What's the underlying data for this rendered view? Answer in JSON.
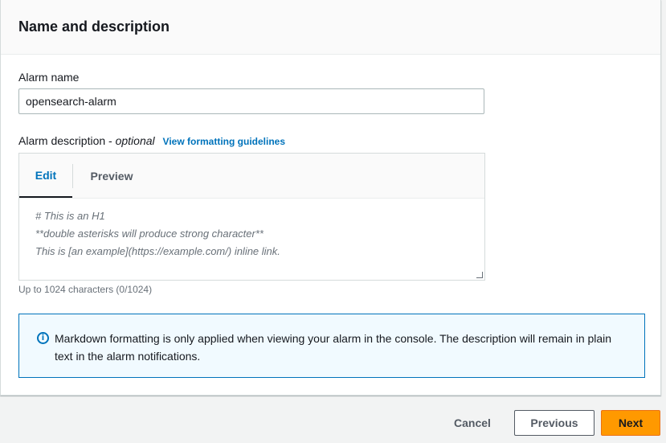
{
  "section": {
    "title": "Name and description"
  },
  "alarm_name": {
    "label": "Alarm name",
    "value": "opensearch-alarm"
  },
  "alarm_description": {
    "label": "Alarm description - ",
    "optional_label": "optional",
    "guidelines_link": "View formatting guidelines",
    "tabs": {
      "edit": "Edit",
      "preview": "Preview"
    },
    "placeholder_lines": [
      "# This is an H1",
      "**double asterisks will produce strong character**",
      "This is [an example](https://example.com/) inline link."
    ],
    "constraint": "Up to 1024 characters (0/1024)"
  },
  "info": {
    "icon": "info-circle-icon",
    "text": "Markdown formatting is only applied when viewing your alarm in the console. The description will remain in plain text in the alarm notifications."
  },
  "footer": {
    "cancel": "Cancel",
    "previous": "Previous",
    "next": "Next"
  },
  "colors": {
    "accent": "#0073bb",
    "primary_button": "#ff9900",
    "info_background": "#f1faff"
  }
}
